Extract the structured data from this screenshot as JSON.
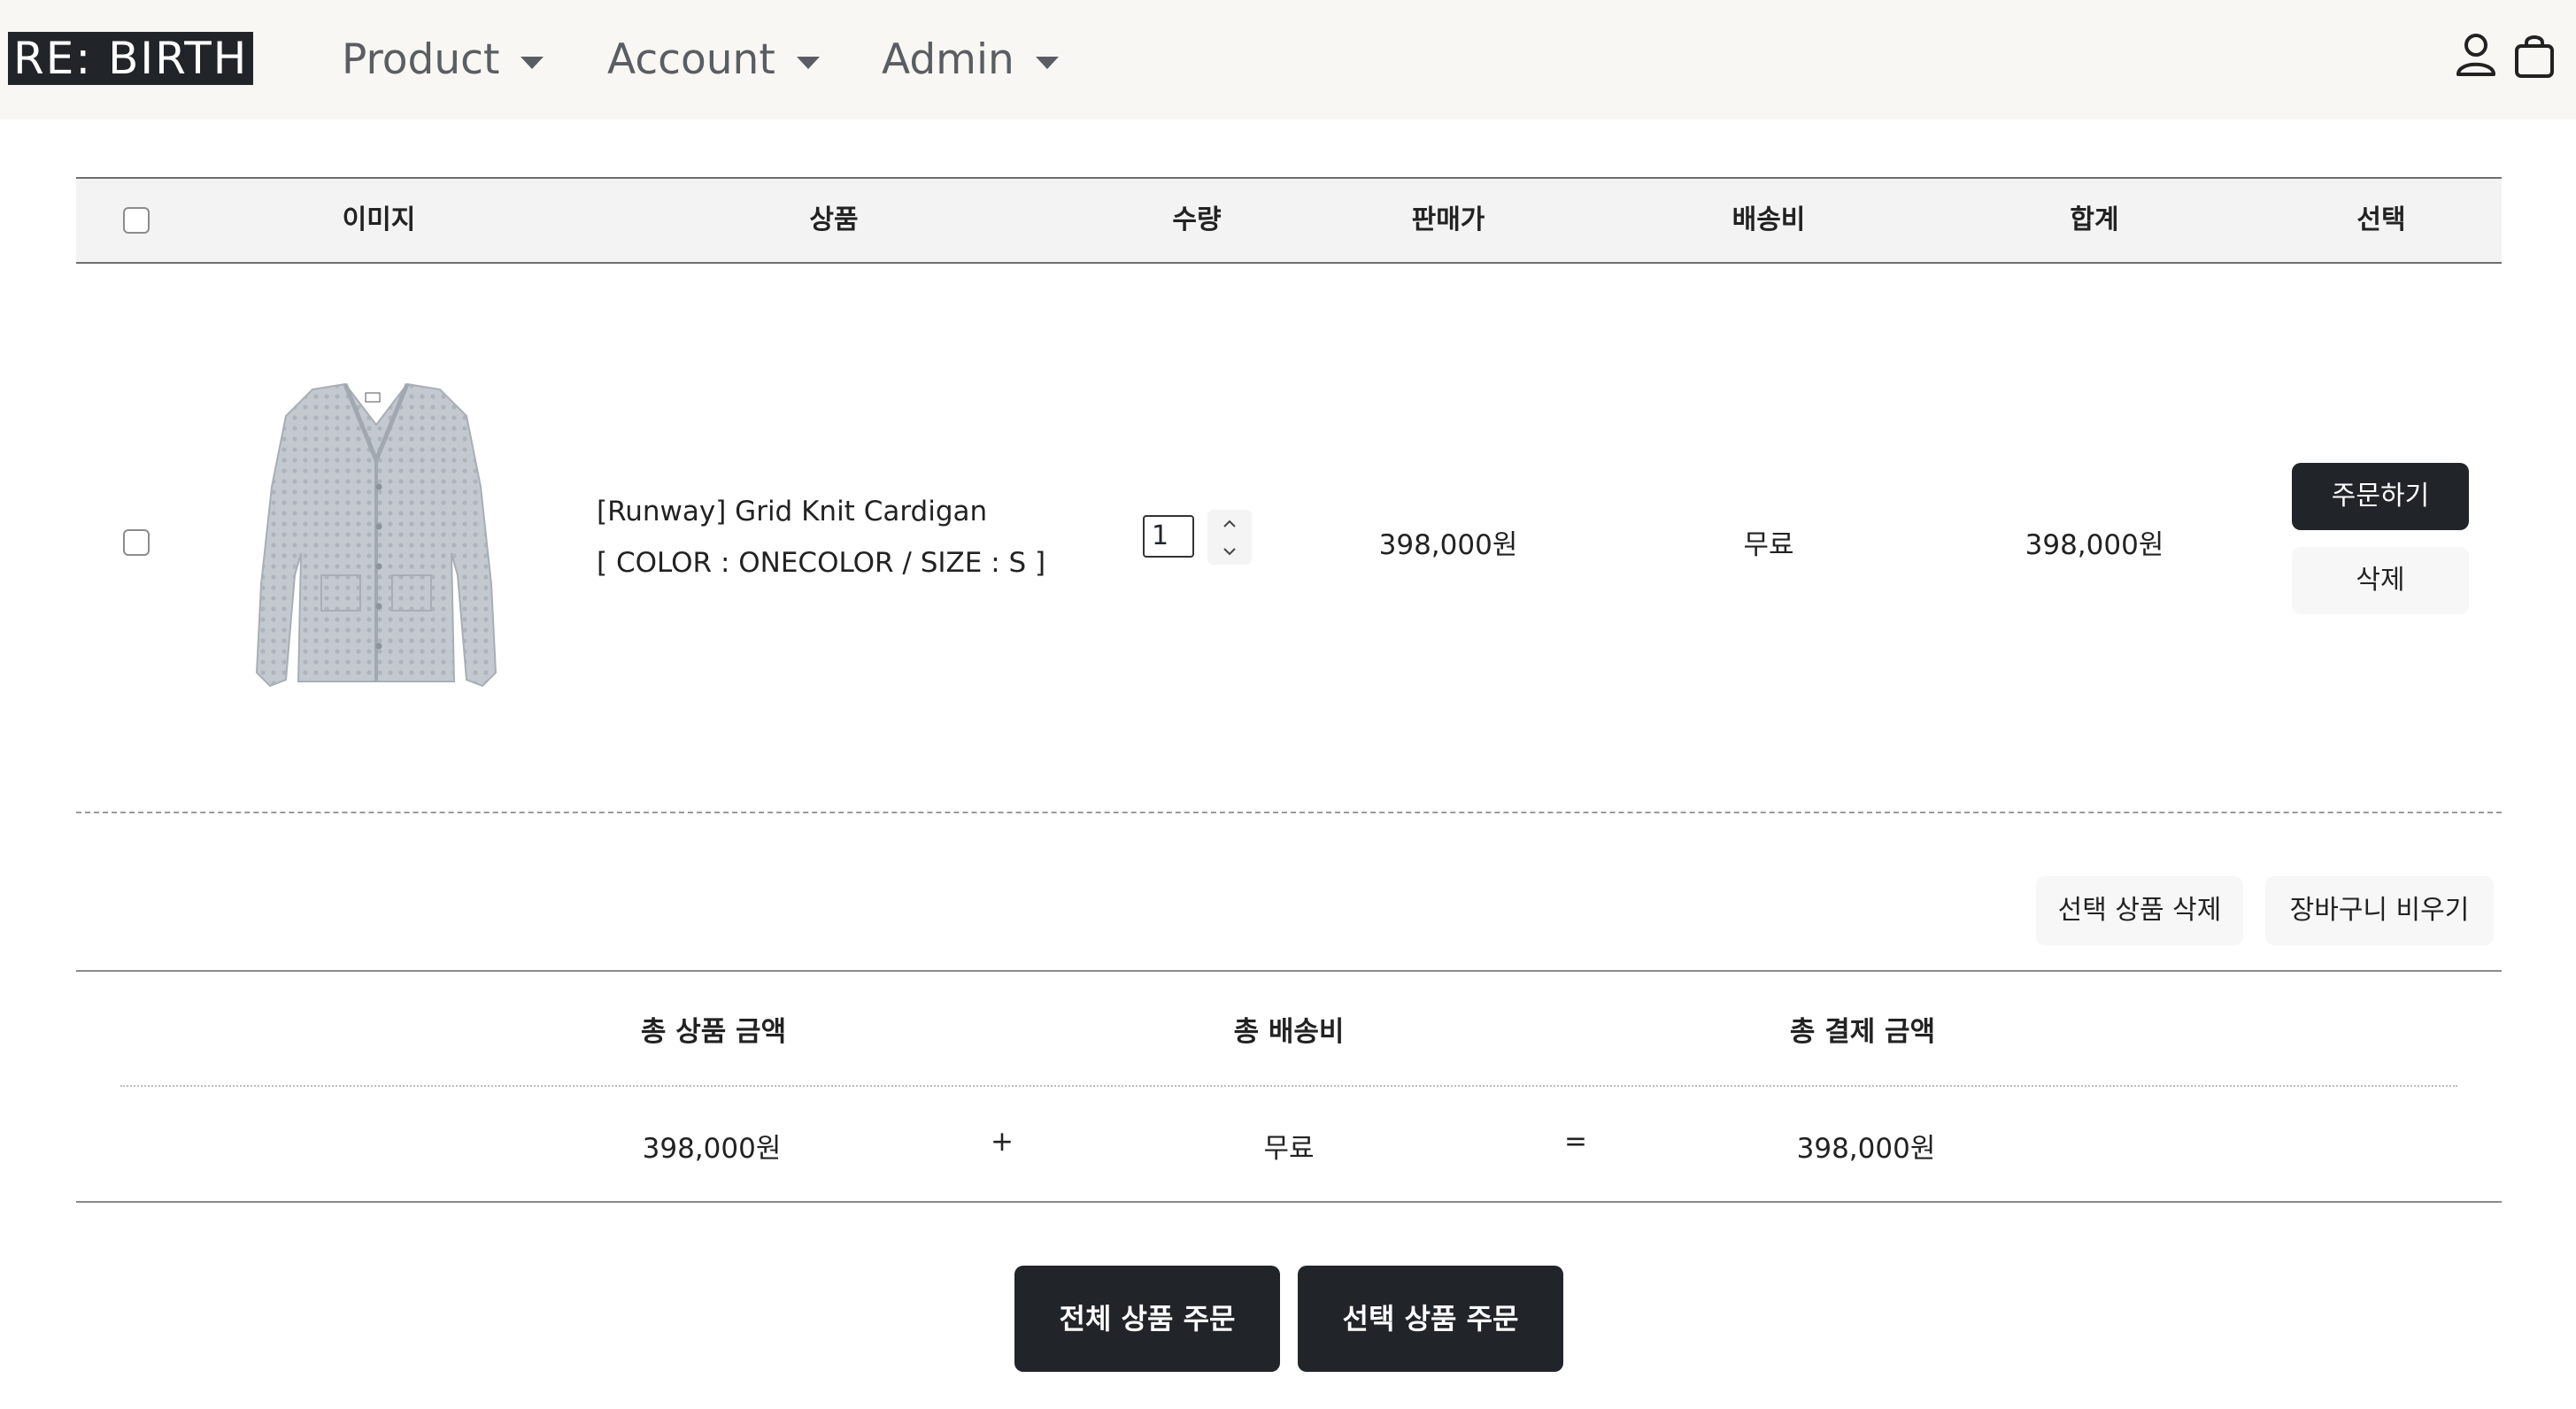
{
  "nav": {
    "brand": "RE: BIRTH",
    "items": [
      {
        "label": "Product"
      },
      {
        "label": "Account"
      },
      {
        "label": "Admin"
      }
    ],
    "icons": [
      "user-icon",
      "shopping-bag-icon"
    ]
  },
  "table": {
    "headers": [
      "이미지",
      "상품",
      "수량",
      "판매가",
      "배송비",
      "합계",
      "선택"
    ]
  },
  "cart_item": {
    "name": "[Runway] Grid Knit Cardigan",
    "option": "[ COLOR : ONECOLOR / SIZE : S ]",
    "quantity": "1",
    "price": "398,000원",
    "shipping": "무료",
    "total": "398,000원",
    "order_button": "주문하기",
    "delete_button": "삭제"
  },
  "actions": {
    "delete_selected": "선택 상품 삭제",
    "empty_cart": "장바구니 비우기"
  },
  "summary": {
    "product_total_label": "총 상품 금액",
    "shipping_total_label": "총 배송비",
    "payment_total_label": "총 결제 금액",
    "product_total": "398,000원",
    "plus": "+",
    "shipping_total": "무료",
    "equals": "=",
    "payment_total": "398,000원"
  },
  "order": {
    "order_all": "전체 상품 주문",
    "order_selected": "선택 상품 주문"
  },
  "colors": {
    "navbar_bg": "#f8f7f4",
    "dark_button": "#212529",
    "light_button": "#f7f7f7",
    "table_header_bg": "#f3f3f3"
  }
}
